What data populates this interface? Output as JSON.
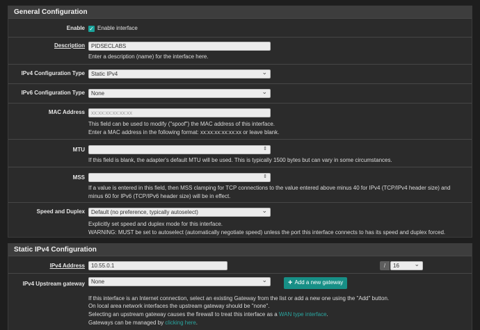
{
  "general": {
    "title": "General Configuration",
    "enable": {
      "label": "Enable",
      "checkbox_label": "Enable interface",
      "checked": true
    },
    "description": {
      "label": "Description",
      "value": "PIDSECLABS",
      "help": "Enter a description (name) for the interface here."
    },
    "ipv4_type": {
      "label": "IPv4 Configuration Type",
      "value": "Static IPv4"
    },
    "ipv6_type": {
      "label": "IPv6 Configuration Type",
      "value": "None"
    },
    "mac": {
      "label": "MAC Address",
      "placeholder": "xx:xx:xx:xx:xx:xx",
      "help1": "This field can be used to modify (\"spoof\") the MAC address of this interface.",
      "help2": "Enter a MAC address in the following format: xx:xx:xx:xx:xx:xx or leave blank."
    },
    "mtu": {
      "label": "MTU",
      "value": "",
      "help": "If this field is blank, the adapter's default MTU will be used. This is typically 1500 bytes but can vary in some circumstances."
    },
    "mss": {
      "label": "MSS",
      "value": "",
      "help1": "If a value is entered in this field, then MSS clamping for TCP connections to the value entered above minus 40 for IPv4 (TCP/IPv4 header size) and",
      "help2": "minus 60 for IPv6 (TCP/IPv6 header size) will be in effect."
    },
    "speed": {
      "label": "Speed and Duplex",
      "value": "Default (no preference, typically autoselect)",
      "help1": "Explicitly set speed and duplex mode for this interface.",
      "help2": "WARNING: MUST be set to autoselect (automatically negotiate speed) unless the port this interface connects to has its speed and duplex forced."
    }
  },
  "static_ipv4": {
    "title": "Static IPv4 Configuration",
    "address": {
      "label": "IPv4 Address",
      "value": "10.55.0.1",
      "slash": "/",
      "cidr": "16"
    },
    "gateway": {
      "label": "IPv4 Upstream gateway",
      "value": "None",
      "add_button": "Add a new gateway",
      "help1": "If this interface is an Internet connection, select an existing Gateway from the list or add a new one using the \"Add\" button.",
      "help2": "On local area network interfaces the upstream gateway should be \"none\".",
      "help3_pre": "Selecting an upstream gateway causes the firewall to treat this interface as a ",
      "help3_link": "WAN type interface",
      "help3_post": ".",
      "help4_pre": "Gateways can be managed by ",
      "help4_link": "clicking here",
      "help4_post": "."
    }
  }
}
